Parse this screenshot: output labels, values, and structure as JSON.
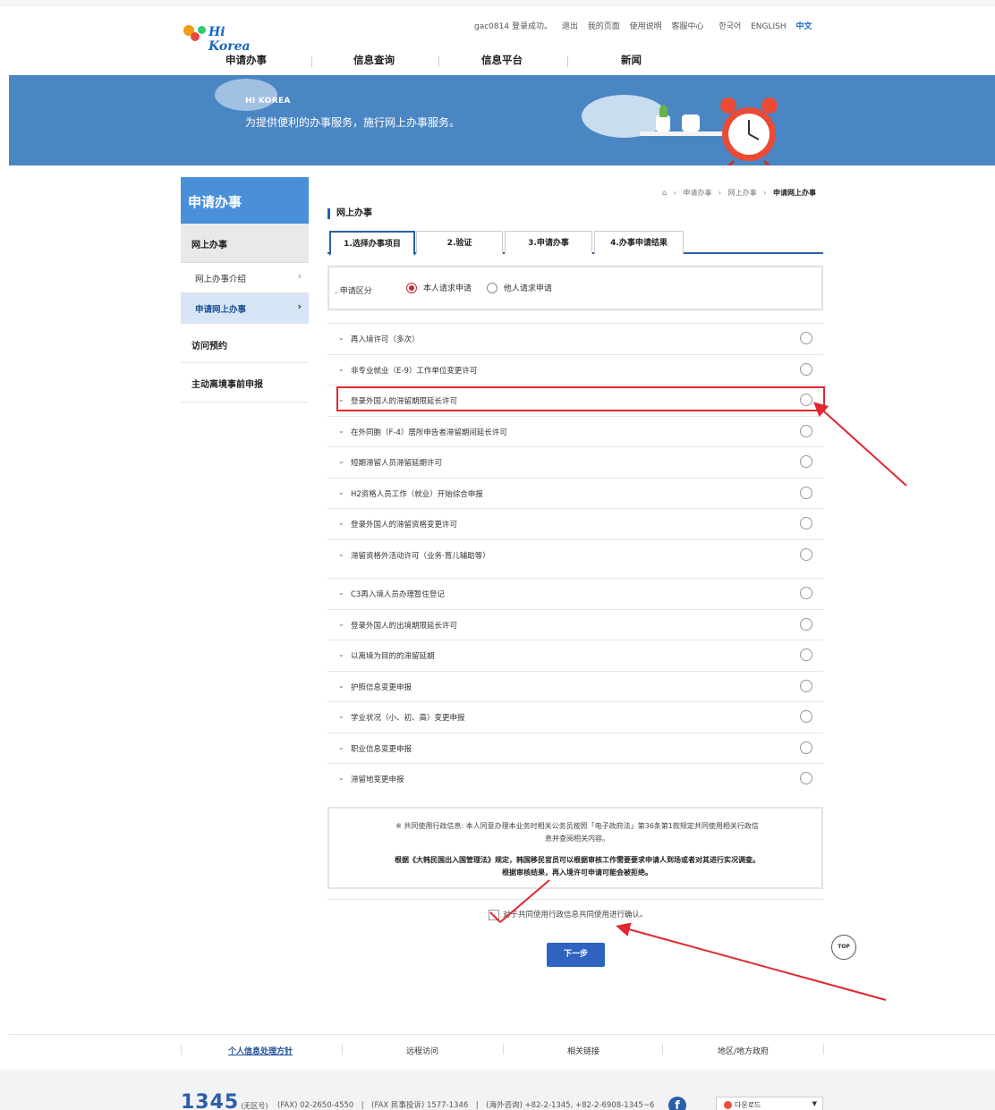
{
  "header": {
    "logo_text": "Hi Korea",
    "util": {
      "login_status": "gac0814 登录成功。",
      "logout": "退出",
      "my_page": "我的页面",
      "guide": "使用说明",
      "help": "客服中心",
      "lang_ko": "한국어",
      "lang_en": "ENGLISH",
      "lang_zh": "中文"
    },
    "gnb": [
      "申请办事",
      "信息查询",
      "信息平台",
      "新闻"
    ]
  },
  "banner": {
    "title": "HI KOREA",
    "subtitle": "为提供便利的办事服务，施行网上办事服务。"
  },
  "sidebar": {
    "title": "申请办事",
    "items": [
      {
        "label": "网上办事"
      },
      {
        "label": "网上办事介绍"
      },
      {
        "label": "申请网上办事"
      },
      {
        "label": "访问预约"
      },
      {
        "label": "主动离境事前申报"
      }
    ]
  },
  "breadcrumb": [
    "申请办事",
    "网上办事",
    "申请网上办事"
  ],
  "section_title": "网上办事",
  "tabs": [
    "1.选择办事项目",
    "2.验证",
    "3.申请办事",
    "4.办事申请结果"
  ],
  "apply_type": {
    "label": "申请区分",
    "options": [
      "本人请求申请",
      "他人请求申请"
    ],
    "selected": "本人请求申请"
  },
  "items": [
    "再入境许可（多次）",
    "非专业就业（E-9）工作单位变更许可",
    "登录外国人的滞留期限延长许可",
    "在外同胞（F-4）居所申告者滞留期间延长许可",
    "短期滞留人员滞留延期许可",
    "H2资格人员工作（就业）开始综合申报",
    "登录外国人的滞留资格变更许可",
    "滞留资格外活动许可（业务·育儿辅助等）",
    "C3再入境人员办理暂住登记",
    "登录外国人的出境期限延长许可",
    "以离境为目的的滞留延期",
    "护照信息变更申报",
    "学业状况（小、初、高）变更申报",
    "职业信息变更申报",
    "滞留地变更申报"
  ],
  "notice": {
    "line1": "※ 共同使用行政信息: 本人同意办理本业务时相关公务员按照「电子政府法」第36条第1款规定共同使用相关行政信",
    "line2": "息并查阅相关内容。",
    "line3": "根据《大韩民国出入国管理法》规定，韩国移民官员可以根据审核工作需要要求申请人到场或者对其进行实况调查。",
    "line4": "根据审核结果，再入境许可申请可能会被拒绝。"
  },
  "agree_label": "对于共同使用行政信息共同使用进行确认。",
  "next_button": "下一步",
  "top_button": "TOP",
  "footer": {
    "links": [
      "个人信息处理方针",
      "远程访问",
      "相关链接",
      "地区/地方政府"
    ],
    "call_number": "1345",
    "call_note": "(无区号)",
    "contacts": "(FAX) 02-2650-4550　|　(FAX 民事投诉) 1577-1346　|　(海外咨询) +82-2-1345, +82-2-6908-1345~6",
    "download": "다운로드"
  },
  "colors": {
    "brand_blue": "#2b5ea8",
    "banner_blue": "#4a86c3",
    "annotation_red": "#e0282e"
  }
}
